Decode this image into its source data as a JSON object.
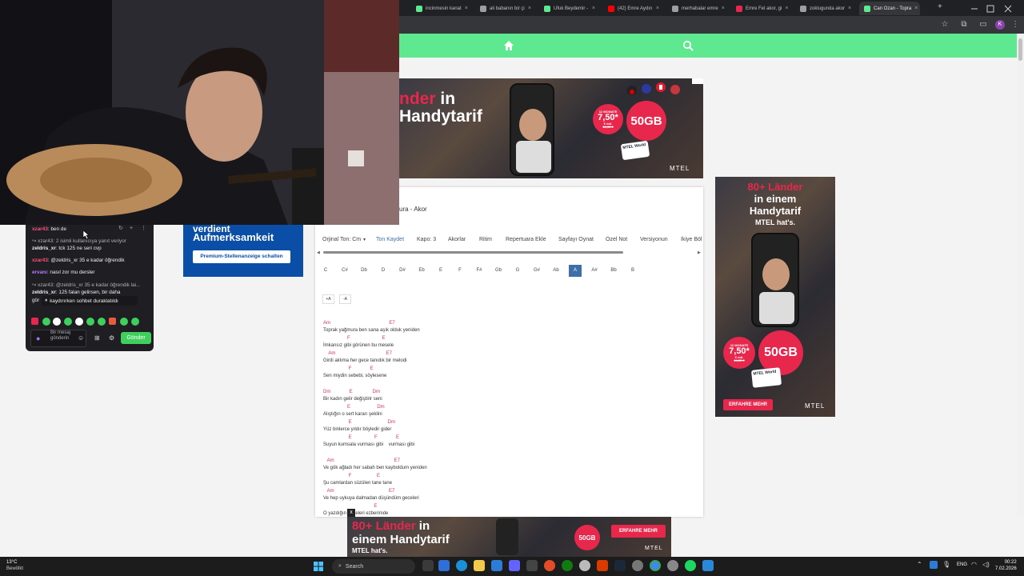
{
  "browser": {
    "tabs": [
      {
        "label": "incinmesin kanat",
        "color": "#5ee88f"
      },
      {
        "label": "ali babanın bir çi",
        "color": "#9aa0a6"
      },
      {
        "label": "Ufuk Beydemir -",
        "color": "#5ee88f"
      },
      {
        "label": "(42) Emre Aydın",
        "color": "#ff0000"
      },
      {
        "label": "merhabalar emre",
        "color": "#9aa0a6"
      },
      {
        "label": "Emre Fel akor, gi",
        "color": "#e8274c"
      },
      {
        "label": "zoklugunda akor",
        "color": "#9aa0a6"
      },
      {
        "label": "Can Ozan - Topra",
        "color": "#5ee88f"
      }
    ],
    "new_tab": "+",
    "close_glyph": "×",
    "profile_initial": "K"
  },
  "site_header": {
    "home_icon": "home-icon",
    "search_icon": "search-icon"
  },
  "ad_top": {
    "headline1": "nder",
    "headline1_suffix": "in",
    "headline2": "Handytarif",
    "months": "12 MONATE",
    "price": "7,50*",
    "price_unit": "€ mtl.",
    "old_price": "14,95 €",
    "gb": "50GB",
    "brand": "MTEL",
    "sim_label": "MTEL World"
  },
  "ad_right": {
    "line1": "80+ Länder",
    "line2": "in einem",
    "line3": "Handytarif",
    "line4": "MTEL hat's.",
    "months": "12 MONATE",
    "price": "7,50*",
    "price_unit": "€ mtl.",
    "old_price": "14,95 €",
    "gb": "50GB",
    "cta": "ERFAHRE MEHR",
    "brand": "MTEL",
    "sim_label": "MTEL World"
  },
  "ad_bottom": {
    "line1": "80+ Länder",
    "line1_suffix": "in",
    "line2": "einem Handytarif",
    "line3": "MTEL hat's.",
    "gb": "50GB",
    "cta": "ERFAHRE MEHR",
    "brand": "MTEL",
    "close": "x"
  },
  "ad_left": {
    "line1": "verdient",
    "line2": "Aufmerksamkeit",
    "cta": "Premium-Stellenanzeige schalten"
  },
  "song": {
    "title": "ura - Akor",
    "toolbar": [
      "Orjinal Ton: Cm",
      "Ton Kaydet",
      "Kapo: 3",
      "Akorlar",
      "Ritim",
      "Repertuara Ekle",
      "Sayfayı Oynat",
      "Ozel Not",
      "Versiyonun",
      "Ikiye Böl"
    ],
    "tones": [
      "C",
      "C#",
      "Db",
      "D",
      "D#",
      "Eb",
      "E",
      "F",
      "F#",
      "Gb",
      "G",
      "G#",
      "Ab",
      "A",
      "A#",
      "Bb",
      "B"
    ],
    "selected_tone": "A",
    "font_buttons": [
      "+A",
      "-A"
    ],
    "lines": [
      {
        "chords": "Am                                            E7",
        "text": "Toprak yağmura ben sana aşık olduk yeniden"
      },
      {
        "chords": "                  F                        E",
        "text": "İmkansız gibi görünen bu mesele"
      },
      {
        "chords": "    Am                                      E7",
        "text": "Girdi aklıma her gece tanıdık bir melodi"
      },
      {
        "chords": "                   F              E",
        "text": "Sen miydin sebebi, söylesene"
      },
      {
        "chords": "",
        "text": ""
      },
      {
        "chords": "Dm              E               Dm",
        "text": "Bir kadın gelir değiştirir seni"
      },
      {
        "chords": "                  E                    Dm",
        "text": "Alıştığın o sert kararı şeklini"
      },
      {
        "chords": "                   E                           Dm",
        "text": "Yüz binlerce yıldır böyledir gider"
      },
      {
        "chords": "                   E                 F              E",
        "text": "Suyun kumsala vurması gibi    vurması gibi"
      },
      {
        "chords": "",
        "text": ""
      },
      {
        "chords": "   Am                                             E7",
        "text": "Ve gök ağladı her sabah ben kayboldum yeniden"
      },
      {
        "chords": "                   F                   E",
        "text": "Şu camlardan süzülen tane tane"
      },
      {
        "chords": "   Am                                         E7",
        "text": "Ve hep uykuya dalmadan düşündüm geceleri"
      },
      {
        "chords": "                                      E",
        "text": "O yazdığın     zeleri ezberimde"
      }
    ]
  },
  "chat": {
    "messages": [
      {
        "type": "msg",
        "user": "xzar43",
        "user_color": "#ff4f7b",
        "text": ": ben de"
      },
      {
        "type": "reply",
        "text": "↪ xzar43: 2 isimli kullanıcıya yanıt veriyor"
      },
      {
        "type": "msg",
        "user": "zeldris_xr",
        "user_color": "#efeff1",
        "text": ": tck 125 ne seri cvp"
      },
      {
        "type": "msg",
        "user": "xzar43",
        "user_color": "#ff4f7b",
        "text": ": @zeldris_xr 35 e kadar öğrendik"
      },
      {
        "type": "msg",
        "user": "ervanı",
        "user_color": "#b57bff",
        "text": ": nasıl zor mu dersler"
      },
      {
        "type": "reply",
        "text": "↪ xzar43: @zeldris_xr 35 e kadar öğrendik lai..."
      },
      {
        "type": "msg",
        "user": "zeldris_xr",
        "user_color": "#efeff1",
        "text": ": 125 falan gelirsen, bir daha"
      },
      {
        "type": "msg",
        "user": "",
        "user_color": "#efeff1",
        "text": "gör"
      }
    ],
    "paused_notice": "kaydırırken sohbet duraklatıldı",
    "input_placeholder": "Bir mesaj gönderin",
    "send_label": "Gönder"
  },
  "taskbar": {
    "temperature": "13°C",
    "weather": "Bewölkt",
    "search_placeholder": "Search",
    "lang": "ENG",
    "time": "00:22",
    "date": "7.02.2026"
  }
}
